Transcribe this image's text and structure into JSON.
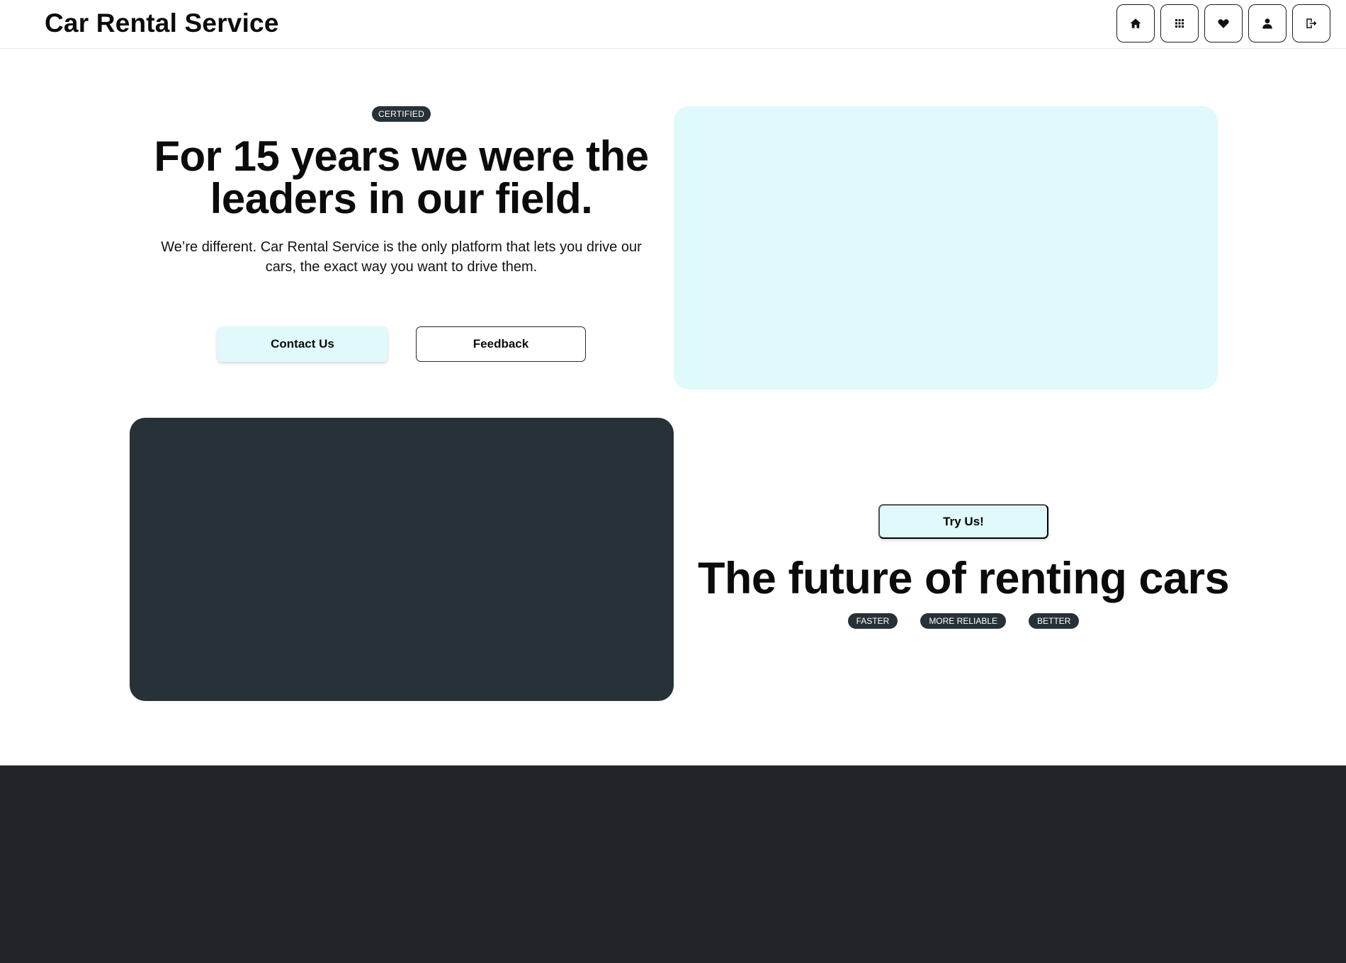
{
  "header": {
    "brand": "Car Rental Service",
    "nav": [
      {
        "icon": "home-icon",
        "label": "Home"
      },
      {
        "icon": "grid-icon",
        "label": "Catalog"
      },
      {
        "icon": "heart-icon",
        "label": "Favorites"
      },
      {
        "icon": "user-icon",
        "label": "Profile"
      },
      {
        "icon": "logout-icon",
        "label": "Log out"
      }
    ]
  },
  "hero": {
    "badge": "Certified",
    "title": "For 15 years we were the leaders in our field.",
    "text": "We’re different. Car Rental Service is the only platform that lets you drive our cars, the exact way you want to drive them.",
    "contact_label": "Contact Us",
    "feedback_label": "Feedback"
  },
  "feature": {
    "try_label": "Try Us!",
    "title": "The future of renting cars",
    "tags": [
      "Faster",
      "More reliable",
      "Better"
    ]
  },
  "colors": {
    "accent_light": "#e0f9fa",
    "dark_panel": "#263238",
    "footer": "#212529"
  }
}
